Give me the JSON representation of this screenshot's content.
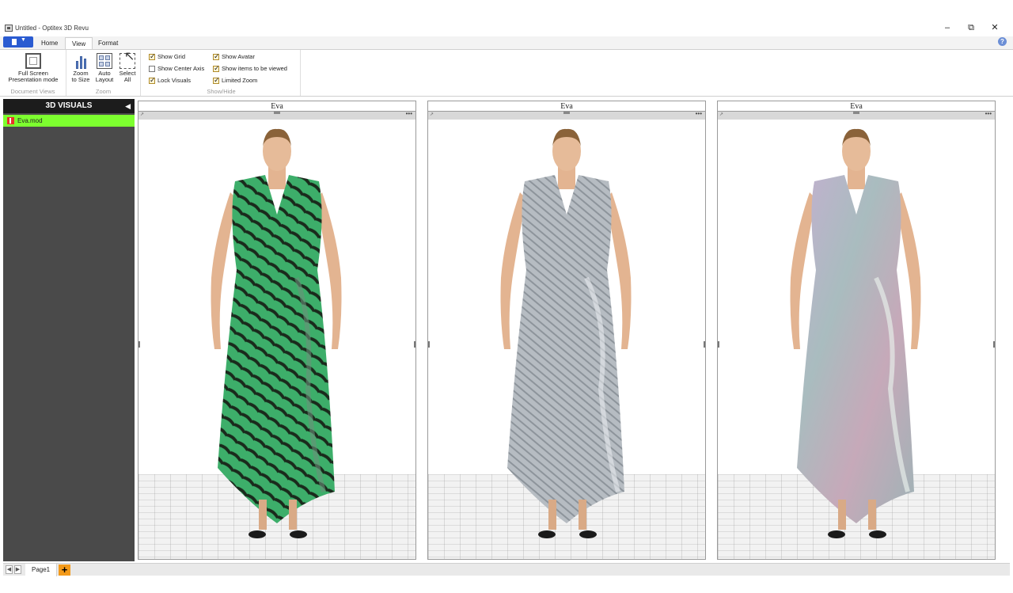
{
  "window": {
    "title": "Untitled - Optitex 3D Revu",
    "controls": {
      "minimize": "–",
      "restore": "⧉",
      "close": "✕"
    }
  },
  "ribbon": {
    "tabs": [
      {
        "label": "Home"
      },
      {
        "label": "View"
      },
      {
        "label": "Format"
      }
    ],
    "active_tab": "View",
    "groups": {
      "document_views": {
        "label": "Document Views",
        "full_screen_line1": "Full Screen",
        "full_screen_line2": "Presentation mode"
      },
      "zoom": {
        "label": "Zoom",
        "zoom_to_size_line1": "Zoom",
        "zoom_to_size_line2": "to Size",
        "auto_layout_line1": "Auto",
        "auto_layout_line2": "Layout",
        "select_all_line1": "Select",
        "select_all_line2": "All"
      },
      "show_hide": {
        "label": "Show/Hide",
        "checkboxes": [
          {
            "label": "Show Grid",
            "checked": true
          },
          {
            "label": "Show Center Axis",
            "checked": false
          },
          {
            "label": "Lock Visuals",
            "checked": true
          },
          {
            "label": "Show Avatar",
            "checked": true
          },
          {
            "label": "Show items to be viewed",
            "checked": true
          },
          {
            "label": "Limited Zoom",
            "checked": true
          }
        ]
      }
    }
  },
  "left_panel": {
    "header": "3D VISUALS",
    "items": [
      {
        "label": "Eva.mod",
        "selected": true
      }
    ]
  },
  "visuals": [
    {
      "title": "Eva",
      "dress": "green zebra print wrap dress",
      "dress_colors": [
        "#3dae6a",
        "#1a2a1c"
      ]
    },
    {
      "title": "Eva",
      "dress": "grey stripe wrap dress",
      "dress_colors": [
        "#b6bcc2",
        "#8d949b"
      ]
    },
    {
      "title": "Eva",
      "dress": "iridescent pastel wrap dress",
      "dress_colors": [
        "#b8a7c4",
        "#9fb3b6"
      ]
    }
  ],
  "pages": {
    "tabs": [
      {
        "label": "Page1"
      }
    ],
    "add_label": "+"
  },
  "colors": {
    "accent_blue": "#2a5bd1",
    "selected_item": "#7dff2f",
    "panel_dark": "#4a4a4a",
    "add_page": "#f39a1a"
  }
}
